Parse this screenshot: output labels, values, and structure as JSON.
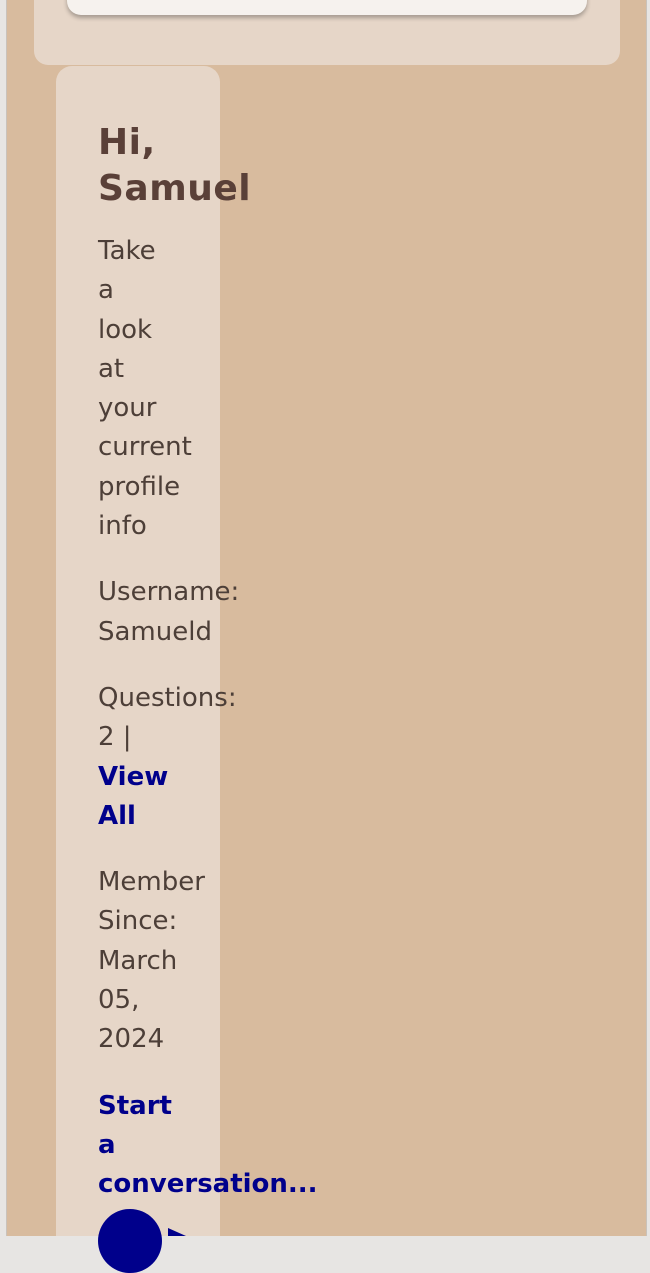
{
  "colors": {
    "page_background": "#d8bb9e",
    "panel": "#e6d6c8",
    "card": "#f6f2ee",
    "heading": "#5a4038",
    "text": "#4d3f38",
    "link": "#00008b"
  },
  "profile": {
    "greeting": "Hi,\nSamuel",
    "subtitle": "Take\na\nlook\nat\nyour\ncurrent\nprofile\ninfo",
    "username_label": "Username:",
    "username_value": "Samueld",
    "questions_label": "Questions:",
    "questions_count": "2 |",
    "view_all_label": "View\nAll",
    "member_since_label": "Member\nSince:",
    "member_since_value": "March\n05,\n2024",
    "start_conversation_label": "Start\na\nconversation..."
  },
  "icons": {
    "avatar": "user-avatar-circle",
    "send": "send-arrow-icon"
  }
}
